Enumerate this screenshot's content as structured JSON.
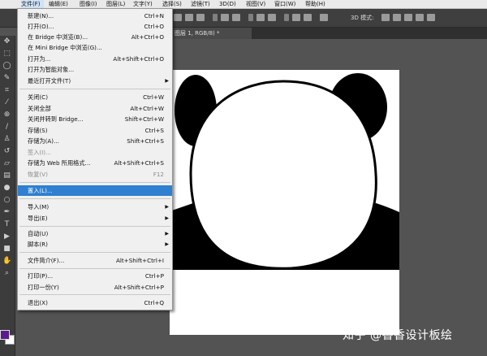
{
  "menubar": {
    "items": [
      {
        "label": "文件(F)"
      },
      {
        "label": "编辑(E)"
      },
      {
        "label": "图像(I)"
      },
      {
        "label": "图层(L)"
      },
      {
        "label": "文字(Y)"
      },
      {
        "label": "选择(S)"
      },
      {
        "label": "滤镜(T)"
      },
      {
        "label": "3D(D)"
      },
      {
        "label": "视图(V)"
      },
      {
        "label": "窗口(W)"
      },
      {
        "label": "帮助(H)"
      }
    ]
  },
  "optionsbar": {
    "mode_label": "3D 模式:"
  },
  "document_tab": {
    "title": "图层 1, RGB/8) *"
  },
  "file_menu": {
    "items": [
      {
        "label": "新建(N)...",
        "shortcut": "Ctrl+N"
      },
      {
        "label": "打开(O)...",
        "shortcut": "Ctrl+O"
      },
      {
        "label": "在 Bridge 中浏览(B)...",
        "shortcut": "Alt+Ctrl+O"
      },
      {
        "label": "在 Mini Bridge 中浏览(G)...",
        "shortcut": ""
      },
      {
        "label": "打开为...",
        "shortcut": "Alt+Shift+Ctrl+O"
      },
      {
        "label": "打开为智能对象...",
        "shortcut": ""
      },
      {
        "label": "最近打开文件(T)",
        "shortcut": ""
      },
      {
        "label": "关闭(C)",
        "shortcut": "Ctrl+W"
      },
      {
        "label": "关闭全部",
        "shortcut": "Alt+Ctrl+W"
      },
      {
        "label": "关闭并转到 Bridge...",
        "shortcut": "Shift+Ctrl+W"
      },
      {
        "label": "存储(S)",
        "shortcut": "Ctrl+S"
      },
      {
        "label": "存储为(A)...",
        "shortcut": "Shift+Ctrl+S"
      },
      {
        "label": "签入(I)...",
        "shortcut": ""
      },
      {
        "label": "存储为 Web 所用格式...",
        "shortcut": "Alt+Shift+Ctrl+S"
      },
      {
        "label": "恢复(V)",
        "shortcut": "F12"
      },
      {
        "label": "置入(L)...",
        "shortcut": ""
      },
      {
        "label": "导入(M)",
        "shortcut": ""
      },
      {
        "label": "导出(E)",
        "shortcut": ""
      },
      {
        "label": "自动(U)",
        "shortcut": ""
      },
      {
        "label": "脚本(R)",
        "shortcut": ""
      },
      {
        "label": "文件简介(F)...",
        "shortcut": "Alt+Shift+Ctrl+I"
      },
      {
        "label": "打印(P)...",
        "shortcut": "Ctrl+P"
      },
      {
        "label": "打印一份(Y)",
        "shortcut": "Alt+Shift+Ctrl+P"
      },
      {
        "label": "退出(X)",
        "shortcut": "Ctrl+Q"
      }
    ]
  },
  "watermark": {
    "text": "知乎 @香香设计板绘"
  },
  "colors": {
    "highlight": "#2f80d0",
    "foreground_swatch": "#5a1b8c",
    "background_swatch": "#ffffff"
  },
  "icons": [
    "ps-logo-icon",
    "move-tool-icon",
    "marquee-tool-icon",
    "lasso-tool-icon",
    "quick-select-icon",
    "crop-tool-icon",
    "eyedropper-icon",
    "healing-brush-icon",
    "brush-tool-icon",
    "clone-stamp-icon",
    "history-brush-icon",
    "eraser-icon",
    "gradient-icon",
    "blur-icon",
    "dodge-icon",
    "pen-tool-icon",
    "type-tool-icon",
    "path-select-icon",
    "shape-tool-icon",
    "hand-tool-icon",
    "zoom-tool-icon",
    "submenu-arrow-icon",
    "panda-illustration"
  ]
}
